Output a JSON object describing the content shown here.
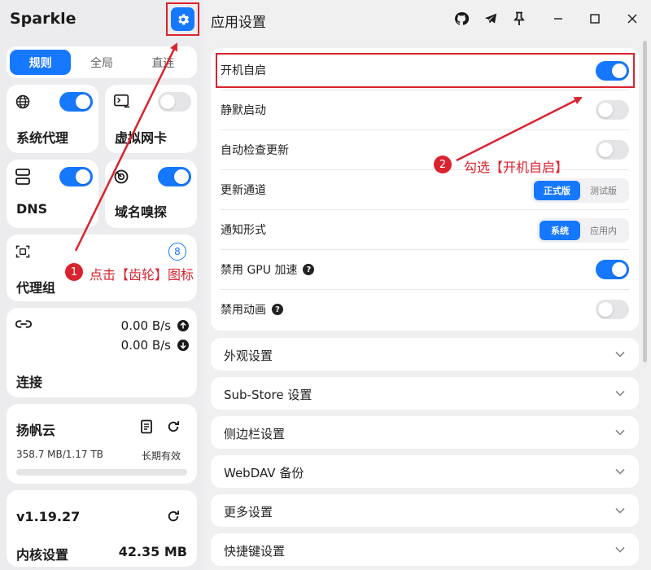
{
  "app": {
    "brand": "Sparkle",
    "page_title": "应用设置"
  },
  "sidebar": {
    "mode_tabs": [
      {
        "label": "规则",
        "active": true
      },
      {
        "label": "全局",
        "active": false
      },
      {
        "label": "直连",
        "active": false
      }
    ],
    "cards": {
      "sysproxy": {
        "label": "系统代理",
        "enabled": true
      },
      "tun": {
        "label": "虚拟网卡",
        "enabled": false
      },
      "dns": {
        "label": "DNS",
        "enabled": true
      },
      "sniff": {
        "label": "域名嗅探",
        "enabled": true
      },
      "proxy_group": {
        "label": "代理组",
        "count": "8"
      },
      "connection": {
        "label": "连接",
        "upload": "0.00 B/s",
        "download": "0.00 B/s"
      },
      "subscription": {
        "name": "扬帆云",
        "usage": "358.7 MB/1.17 TB",
        "expiry": "长期有效",
        "progress": 0.0
      },
      "core": {
        "version": "v1.19.27",
        "label": "内核设置",
        "memory": "42.35 MB"
      }
    }
  },
  "settings": {
    "rows": [
      {
        "label": "开机自启",
        "type": "toggle",
        "enabled": true
      },
      {
        "label": "静默启动",
        "type": "toggle",
        "enabled": false
      },
      {
        "label": "自动检查更新",
        "type": "toggle",
        "enabled": false
      },
      {
        "label": "更新通道",
        "type": "seg",
        "options": [
          "正式版",
          "测试版"
        ],
        "active": 0
      },
      {
        "label": "通知形式",
        "type": "seg",
        "options": [
          "系统",
          "应用内"
        ],
        "active": 0
      },
      {
        "label": "禁用 GPU 加速",
        "type": "toggle",
        "enabled": true,
        "help": "?"
      },
      {
        "label": "禁用动画",
        "type": "toggle",
        "enabled": false,
        "help": "?"
      }
    ],
    "sections": [
      "外观设置",
      "Sub-Store 设置",
      "侧边栏设置",
      "WebDAV 备份",
      "更多设置",
      "快捷键设置"
    ]
  },
  "annotations": {
    "step1": {
      "num": "1",
      "text": "点击【齿轮】图标"
    },
    "step2": {
      "num": "2",
      "text": "勾选【开机自启】"
    }
  },
  "colors": {
    "accent": "#1677ff",
    "annotation": "#d9232e"
  }
}
